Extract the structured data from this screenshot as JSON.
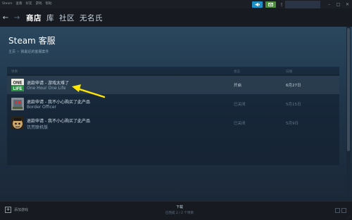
{
  "menubar": {
    "items": [
      "Steam",
      "查看",
      "好友",
      "游戏",
      "帮助"
    ],
    "notify_icon": "broadcast-icon",
    "mail_icon": "envelope-icon",
    "bell": "!",
    "controls": [
      "–",
      "□",
      "✕"
    ]
  },
  "nav": {
    "back": "←",
    "forward": "→",
    "links": [
      "商店",
      "库",
      "社区",
      "无名氏"
    ]
  },
  "page": {
    "title": "Steam 客服",
    "breadcrumb_home": "主页",
    "breadcrumb_sep": " > ",
    "breadcrumb_current": "我最近的客服案件"
  },
  "table": {
    "headers": {
      "item": "项目",
      "status": "状态",
      "date": "日期"
    },
    "rows": [
      {
        "title": "退款申请 - 游戏太难了",
        "sub": "One Hour One Life",
        "status": "开启",
        "date": "6月27日",
        "thumb": "ohol-thumb"
      },
      {
        "title": "退款申请 - 我不小心购买了此产品",
        "sub": "Border Officer",
        "status": "已关闭",
        "date": "5月15日",
        "thumb": "border-officer-thumb"
      },
      {
        "title": "退款申请 - 我不小心购买了此产品",
        "sub": "饥荒联机版",
        "status": "已关闭",
        "date": "5月9日",
        "thumb": "dont-starve-thumb"
      }
    ],
    "thumb_labels": {
      "ohol_line1": "ONE",
      "ohol_line2": "LIFE"
    }
  },
  "bottom": {
    "add_game": "添加游戏",
    "download_title": "下载",
    "download_status": "已完成 2 / 2 个项目"
  },
  "colors": {
    "accent_blue": "#1d8fc7",
    "accent_green": "#4c8d3d",
    "arrow": "#ffe600"
  }
}
